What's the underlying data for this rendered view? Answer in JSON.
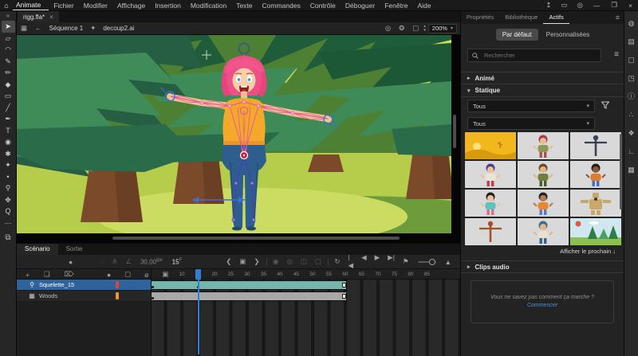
{
  "menubar": {
    "app_label": "Animate",
    "home_glyph": "⌂",
    "menus": [
      "Fichier",
      "Modifier",
      "Affichage",
      "Insertion",
      "Modification",
      "Texte",
      "Commandes",
      "Contrôle",
      "Déboguer",
      "Fenêtre",
      "Aide"
    ],
    "right_icons": [
      {
        "name": "share-icon",
        "glyph": "↥"
      },
      {
        "name": "workspace-switcher-icon",
        "glyph": "▭"
      },
      {
        "name": "profile-icon",
        "glyph": "◎"
      }
    ],
    "window_controls": {
      "minimize": "—",
      "restore": "❐",
      "close": "×"
    }
  },
  "document": {
    "tab_title": "rigg.fla*",
    "tab_close": "×",
    "scene_label": "Séquence 1",
    "symbol_label": "decoup2.ai",
    "zoom_level": "200%",
    "edit_left_icons": [
      {
        "name": "scene-clapper-icon",
        "glyph": "▦"
      },
      {
        "name": "back-arrow-icon",
        "glyph": "←"
      }
    ],
    "symbol_icon_glyph": "✦",
    "edit_right_icons": [
      {
        "name": "zoom-fit-icon",
        "glyph": "◎"
      },
      {
        "name": "onion-skin-icon",
        "glyph": "❂"
      },
      {
        "name": "center-stage-icon",
        "glyph": "▢"
      }
    ]
  },
  "toolbar": {
    "collapse_glyph": "»",
    "pasteboard_glyph": "⧉",
    "tools": [
      {
        "name": "selection-tool",
        "glyph": "➤",
        "selected": true
      },
      {
        "name": "free-transform-tool",
        "glyph": "▱",
        "selected": false
      },
      {
        "name": "lasso-tool",
        "glyph": "◠",
        "selected": false
      },
      {
        "name": "fluid-brush-tool",
        "glyph": "✎",
        "selected": false
      },
      {
        "name": "pencil-tool",
        "glyph": "✏",
        "selected": false
      },
      {
        "name": "shape-brush-tool",
        "glyph": "◆",
        "selected": false
      },
      {
        "name": "rectangle-tool",
        "glyph": "▭",
        "selected": false
      },
      {
        "name": "line-tool",
        "glyph": "╱",
        "selected": false
      },
      {
        "name": "pen-tool",
        "glyph": "✒",
        "selected": false
      },
      {
        "name": "text-tool",
        "glyph": "T",
        "selected": false
      },
      {
        "name": "paint-bucket-tool",
        "glyph": "◉",
        "selected": false
      },
      {
        "name": "classic-brush-tool",
        "glyph": "✱",
        "selected": false
      },
      {
        "name": "asset-warp-tool",
        "glyph": "✦",
        "selected": false
      },
      {
        "name": "width-tool",
        "glyph": "•",
        "selected": false
      },
      {
        "name": "bone-tool",
        "glyph": "⚲",
        "selected": false
      },
      {
        "name": "hand-tool",
        "glyph": "✥",
        "selected": false
      },
      {
        "name": "zoom-tool",
        "glyph": "Q",
        "selected": false
      },
      {
        "name": "more-tools",
        "glyph": "⋯",
        "selected": false
      }
    ]
  },
  "timeline": {
    "tabs": [
      {
        "label": "Scénario",
        "active": true
      },
      {
        "label": "Sortie",
        "active": false
      }
    ],
    "record_icon": {
      "name": "timeline-record-icon",
      "glyph": "●"
    },
    "view_icons": [
      {
        "name": "timeline-eye-icon",
        "glyph": "◌"
      },
      {
        "name": "timeline-hierarchy-icon",
        "glyph": "⋔"
      },
      {
        "name": "timeline-graph-icon",
        "glyph": "∠"
      }
    ],
    "frame_rate": "30,00",
    "frame_rate_unit": "ips",
    "current_frame": "15",
    "current_frame_unit": "F",
    "nav_icons": [
      {
        "name": "prev-keyframe-icon",
        "glyph": "❮"
      },
      {
        "name": "center-frame-icon",
        "glyph": "▣"
      },
      {
        "name": "next-keyframe-icon",
        "glyph": "❯"
      }
    ],
    "onion_icons": [
      {
        "name": "onion-skin-icon",
        "glyph": "◉"
      },
      {
        "name": "onion-outline-icon",
        "glyph": "◎"
      },
      {
        "name": "onion-range-icon",
        "glyph": "◫"
      },
      {
        "name": "edit-multiple-frames-icon",
        "glyph": "▢"
      }
    ],
    "loop_icon": {
      "name": "loop-icon",
      "glyph": "↻"
    },
    "play_icons": [
      {
        "name": "go-first-frame-icon",
        "glyph": "|◀"
      },
      {
        "name": "step-back-icon",
        "glyph": "◀"
      },
      {
        "name": "play-icon",
        "glyph": "▶"
      },
      {
        "name": "step-forward-icon",
        "glyph": "▶|"
      }
    ],
    "right_icons_a": {
      "name": "marker-icon",
      "glyph": "⚑"
    },
    "right_icons_b": {
      "name": "resize-frames-icon",
      "glyph": "▲"
    },
    "layer_header_left": [
      {
        "name": "new-layer-icon",
        "glyph": "+"
      },
      {
        "name": "new-folder-icon",
        "glyph": "❏"
      },
      {
        "name": "delete-layer-icon",
        "glyph": "⌦"
      }
    ],
    "layer_header_right": [
      {
        "name": "layers-highlight-icon",
        "glyph": "●"
      },
      {
        "name": "layers-outline-icon",
        "glyph": "▢"
      },
      {
        "name": "layers-visibility-icon",
        "glyph": "ø"
      },
      {
        "name": "layers-lock-icon",
        "glyph": "▣"
      }
    ],
    "layers": [
      {
        "name": "Squelette_15",
        "selected": true,
        "icon_glyph": "⚲",
        "chip_color": "#e0443a",
        "span_fill": "#76b5ab",
        "span_start": 1,
        "span_end": 60,
        "keyframes": [
          1,
          15
        ],
        "end_marker": true
      },
      {
        "name": "Woods",
        "selected": false,
        "icon_glyph": "▦",
        "chip_color": "#e8973a",
        "span_fill": "#a8a8a8",
        "span_start": 1,
        "span_end": 60,
        "keyframes": [
          1
        ],
        "end_marker": true
      }
    ],
    "ruler": {
      "start": 5,
      "step": 5,
      "end": 85
    },
    "playhead_frame": 15
  },
  "right_panel": {
    "tabs": [
      {
        "label": "Propriétés",
        "active": false
      },
      {
        "label": "Bibliothèque",
        "active": false
      },
      {
        "label": "Actifs",
        "active": true
      }
    ],
    "menu_icon_glyph": "≡",
    "filter_tabs": [
      {
        "label": "Par défaut",
        "active": true
      },
      {
        "label": "Personnalisées",
        "active": false
      }
    ],
    "search": {
      "placeholder": "Rechercher"
    },
    "list_icon_glyph": "≡",
    "sections": [
      {
        "label": "Animé",
        "chevron": "▸",
        "expanded": false
      },
      {
        "label": "Statique",
        "chevron": "▾",
        "expanded": true
      }
    ],
    "dropdowns": [
      {
        "value": "Tous",
        "chevron": "▾"
      },
      {
        "value": "Tous",
        "chevron": "▾"
      }
    ],
    "thumbnails": [
      {
        "kind": "scene-desert",
        "label": "desert-scene"
      },
      {
        "kind": "figure",
        "label": "girl-red",
        "hair": "#a33b52",
        "skin": "#f0b98e",
        "top": "#8a9a55",
        "bottom": "#b34d4d"
      },
      {
        "kind": "tpose",
        "label": "rig-dark",
        "color": "#3a3f55"
      },
      {
        "kind": "figure",
        "label": "girl-blue",
        "hair": "#4a3f8e",
        "skin": "#f2c193",
        "top": "#e8e4da",
        "bottom": "#c23b52"
      },
      {
        "kind": "figure",
        "label": "boy-olive",
        "hair": "#6b4a2b",
        "skin": "#e8b586",
        "top": "#6e7f3e",
        "bottom": "#4e5a2c"
      },
      {
        "kind": "figure",
        "label": "girl-orange",
        "hair": "#241c1c",
        "skin": "#8a5a3a",
        "top": "#e07b30",
        "bottom": "#3f6fbf"
      },
      {
        "kind": "figure",
        "label": "girl-teal",
        "hair": "#241f1f",
        "skin": "#f0c3a0",
        "top": "#59c4c0",
        "bottom": "#e06a8a"
      },
      {
        "kind": "figure",
        "label": "boy-afro",
        "hair": "#2a2222",
        "skin": "#b97a4e",
        "top": "#e8872e",
        "bottom": "#5a7ac4"
      },
      {
        "kind": "robot",
        "label": "robot-tan",
        "color": "#c8a96a"
      },
      {
        "kind": "tpose",
        "label": "rig-red",
        "color": "#a0522d"
      },
      {
        "kind": "figure",
        "label": "boy-cap",
        "hair": "#3a6c8e",
        "skin": "#e8b586",
        "top": "#e8e0d0",
        "bottom": "#3a5f8e"
      },
      {
        "kind": "scene-forest",
        "label": "forest-scene"
      }
    ],
    "show_next_label": "Afficher le prochain ↓",
    "audio_section": {
      "label": "Clips audio",
      "chevron": "▸"
    },
    "audio_hint_text": "Vous ne savez pas comment ça marche ? ",
    "audio_hint_link": "Commencer"
  },
  "dock_icons": [
    {
      "name": "assets-panel-icon",
      "glyph": "◍"
    },
    {
      "name": "library-panel-icon",
      "glyph": "▤"
    },
    {
      "name": "frame-picker-panel-icon",
      "glyph": "▢"
    },
    {
      "name": "export-panel-icon",
      "glyph": "◳"
    },
    {
      "name": "info-panel-icon",
      "glyph": "ⓘ"
    },
    {
      "name": "history-panel-icon",
      "glyph": "∴"
    },
    {
      "name": "character-panel-icon",
      "glyph": "❖"
    },
    {
      "name": "motion-editor-panel-icon",
      "glyph": "∟"
    },
    {
      "name": "keyboard-panel-icon",
      "glyph": "▦"
    }
  ],
  "colors": {
    "accent_blue": "#2f7fd4",
    "layer_selected_blue": "#2e639c",
    "span_teal": "#76b5ab",
    "span_gray": "#a8a8a8",
    "stage_background_green": "#4e8033",
    "ground_green": "#b6cd4b",
    "hair_pink": "#ee4f86",
    "shirt_yellow": "#f4a92b",
    "jeans_blue": "#2d5e8d",
    "rig_pink": "#e85a9b",
    "rig_blue": "#3d6fd6"
  }
}
